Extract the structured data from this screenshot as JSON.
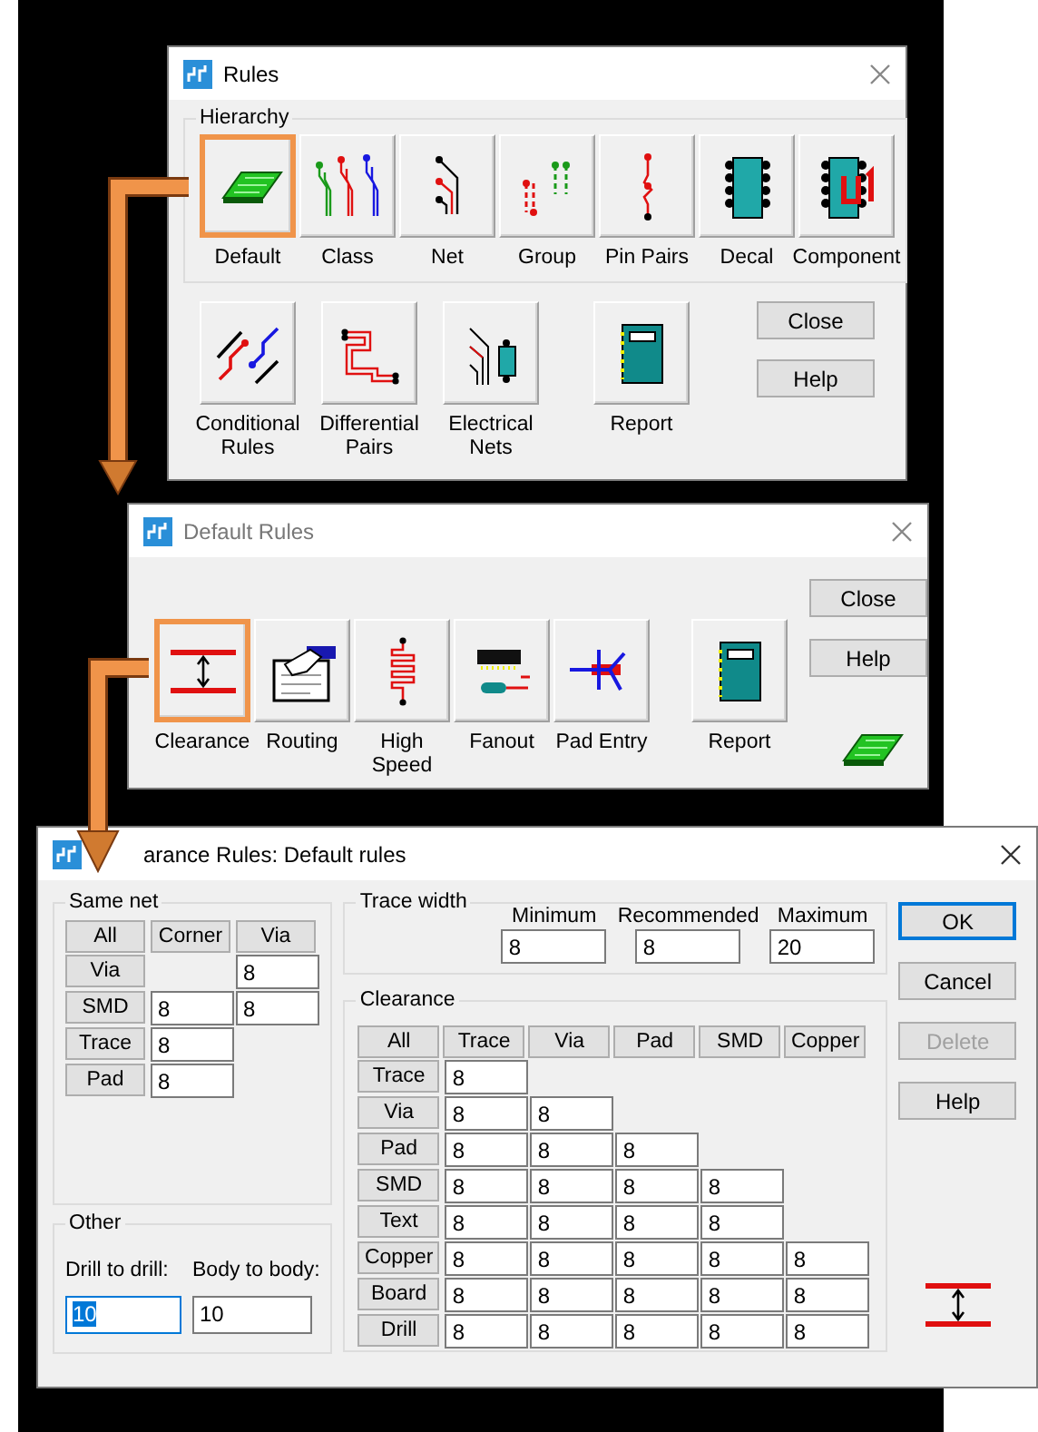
{
  "rules_window": {
    "title": "Rules",
    "hierarchy": {
      "label": "Hierarchy",
      "buttons": [
        {
          "label": "Default",
          "kind": "board",
          "highlighted": true
        },
        {
          "label": "Class",
          "kind": "class",
          "highlighted": false
        },
        {
          "label": "Net",
          "kind": "net",
          "highlighted": false
        },
        {
          "label": "Group",
          "kind": "group",
          "highlighted": false
        },
        {
          "label": "Pin Pairs",
          "kind": "pinpairs",
          "highlighted": false
        },
        {
          "label": "Decal",
          "kind": "decal",
          "highlighted": false
        },
        {
          "label": "Component",
          "kind": "component",
          "highlighted": false
        }
      ]
    },
    "tools": [
      {
        "label": "Conditional Rules",
        "kind": "conditional",
        "highlighted": false
      },
      {
        "label": "Differential Pairs",
        "kind": "diffpairs",
        "highlighted": false
      },
      {
        "label": "Electrical Nets",
        "kind": "electrical",
        "highlighted": false
      },
      {
        "label": "Report",
        "kind": "report",
        "highlighted": false
      }
    ],
    "side_buttons": [
      "Close",
      "Help"
    ]
  },
  "default_rules_window": {
    "title": "Default Rules",
    "tools": [
      {
        "label": "Clearance",
        "kind": "clearance",
        "highlighted": true
      },
      {
        "label": "Routing",
        "kind": "routing",
        "highlighted": false
      },
      {
        "label": "High Speed",
        "kind": "highspeed",
        "highlighted": false
      },
      {
        "label": "Fanout",
        "kind": "fanout",
        "highlighted": false
      },
      {
        "label": "Pad Entry",
        "kind": "padentry",
        "highlighted": false
      },
      {
        "label": "Report",
        "kind": "report",
        "highlighted": false
      }
    ],
    "side_buttons": [
      "Close",
      "Help"
    ]
  },
  "clearance_window": {
    "title": "arance Rules: Default rules",
    "same_net": {
      "label": "Same net",
      "all_button": "All",
      "columns": [
        "Corner",
        "Via"
      ],
      "rows": [
        {
          "label": "Via",
          "cells": [
            "",
            "8"
          ]
        },
        {
          "label": "SMD",
          "cells": [
            "8",
            "8"
          ]
        },
        {
          "label": "Trace",
          "cells": [
            "8"
          ]
        },
        {
          "label": "Pad",
          "cells": [
            "8"
          ]
        }
      ]
    },
    "other": {
      "label": "Other",
      "fields": [
        {
          "label": "Drill to drill:",
          "value": "10",
          "selected": true
        },
        {
          "label": "Body to body:",
          "value": "10",
          "selected": false
        }
      ]
    },
    "trace_width": {
      "label": "Trace width",
      "fields": [
        {
          "label": "Minimum",
          "value": "8"
        },
        {
          "label": "Recommended",
          "value": "8"
        },
        {
          "label": "Maximum",
          "value": "20"
        }
      ]
    },
    "clearance": {
      "label": "Clearance",
      "all_button": "All",
      "columns": [
        "Trace",
        "Via",
        "Pad",
        "SMD",
        "Copper"
      ],
      "rows": [
        {
          "label": "Trace",
          "cells": [
            "8"
          ]
        },
        {
          "label": "Via",
          "cells": [
            "8",
            "8"
          ]
        },
        {
          "label": "Pad",
          "cells": [
            "8",
            "8",
            "8"
          ]
        },
        {
          "label": "SMD",
          "cells": [
            "8",
            "8",
            "8",
            "8"
          ]
        },
        {
          "label": "Text",
          "cells": [
            "8",
            "8",
            "8",
            "8"
          ]
        },
        {
          "label": "Copper",
          "cells": [
            "8",
            "8",
            "8",
            "8",
            "8"
          ]
        },
        {
          "label": "Board",
          "cells": [
            "8",
            "8",
            "8",
            "8",
            "8"
          ]
        },
        {
          "label": "Drill",
          "cells": [
            "8",
            "8",
            "8",
            "8",
            "8"
          ]
        }
      ]
    },
    "buttons": [
      {
        "label": "OK",
        "default": true,
        "disabled": false
      },
      {
        "label": "Cancel",
        "default": false,
        "disabled": false
      },
      {
        "label": "Delete",
        "default": false,
        "disabled": true
      },
      {
        "label": "Help",
        "default": false,
        "disabled": false
      }
    ]
  }
}
